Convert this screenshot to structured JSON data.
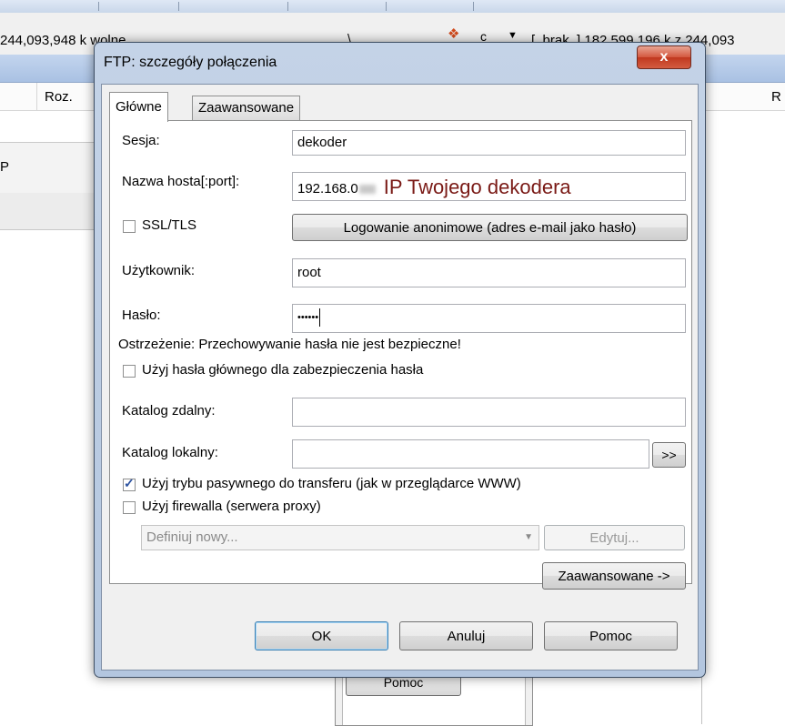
{
  "background": {
    "free_left": "244,093,948 k wolne",
    "backslash": "\\",
    "drive_letter": "c",
    "free_right": "[_brak_] 182,599,196 k z 244,093",
    "col_roz": "Roz.",
    "col_r": "R",
    "left_item": "P",
    "pomoc_behind": "Pomoc"
  },
  "dialog": {
    "title": "FTP: szczegóły połączenia",
    "close_label": "x",
    "tabs": [
      {
        "label": "Główne",
        "active": true
      },
      {
        "label": "Zaawansowane",
        "active": false
      }
    ],
    "session_label": "Sesja:",
    "session_value": "dekoder",
    "host_label": "Nazwa hosta[:port]:",
    "host_value_start": "192.168.0",
    "host_hint": "IP Twojego dekodera",
    "ssl_label": "SSL/TLS",
    "anon_button": "Logowanie anonimowe (adres e-mail jako hasło)",
    "user_label": "Użytkownik:",
    "user_value": "root",
    "password_label": "Hasło:",
    "password_value": "••••••",
    "warning": "Ostrzeżenie: Przechowywanie hasła nie jest bezpieczne!",
    "master_password_label": "Użyj hasła głównego dla zabezpieczenia hasła",
    "remote_dir_label": "Katalog zdalny:",
    "remote_dir_value": "",
    "local_dir_label": "Katalog lokalny:",
    "local_dir_value": "",
    "browse_button": ">>",
    "passive_label": "Użyj trybu pasywnego do transferu (jak w przeglądarce WWW)",
    "passive_checked": true,
    "firewall_label": "Użyj firewalla (serwera proxy)",
    "firewall_checked": false,
    "proxy_select": "Definiuj nowy...",
    "edit_button": "Edytuj...",
    "advanced_button": "Zaawansowane ->",
    "ok_button": "OK",
    "cancel_button": "Anuluj",
    "help_button": "Pomoc"
  }
}
